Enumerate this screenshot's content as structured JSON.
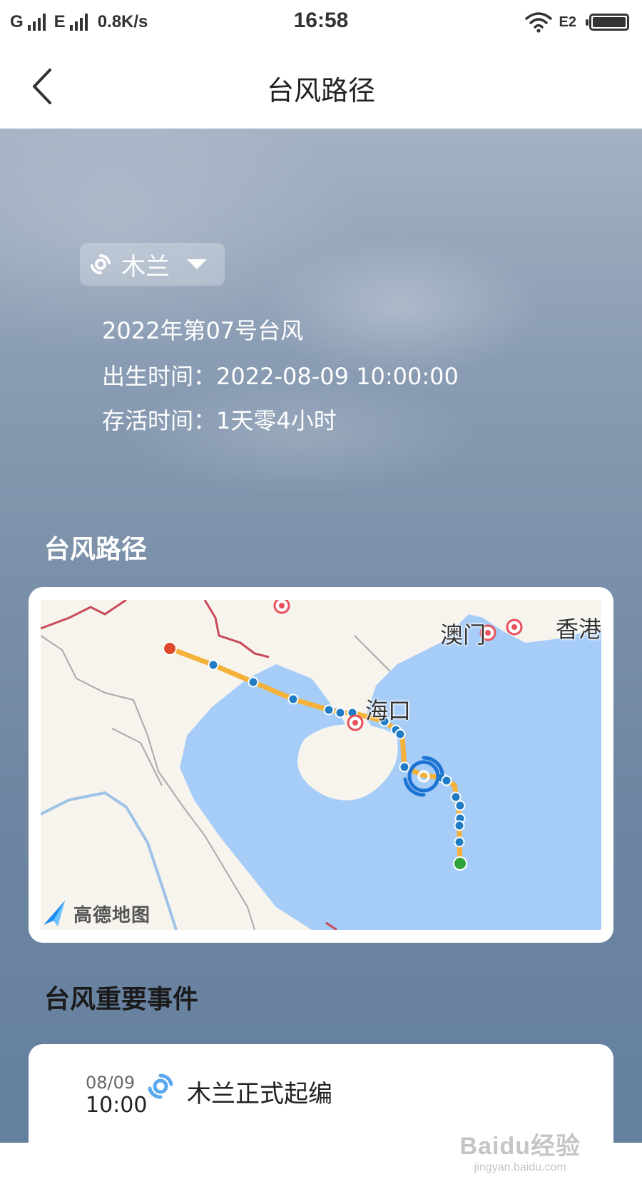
{
  "status_bar": {
    "sim1": "G",
    "sim2": "E",
    "speed": "0.8K/s",
    "time": "16:58",
    "network_badge": "E2",
    "icons": [
      "signal-icon",
      "wifi-icon",
      "battery-icon"
    ]
  },
  "nav": {
    "title": "台风路径"
  },
  "typhoon": {
    "name": "木兰",
    "code_label": "2022年第07号台风",
    "birth_label": "出生时间：2022-08-09 10:00:00",
    "alive_label": "存活时间：1天零4小时",
    "icon": "typhoon-icon"
  },
  "sections": {
    "path_title": "台风路径",
    "events_title": "台风重要事件"
  },
  "map": {
    "provider": "高德地图",
    "labels": {
      "haikou": "海口",
      "macau": "澳门",
      "hongkong": "香港"
    },
    "colors": {
      "sea": "#a6cdf8",
      "land": "#f7f4ee",
      "track": "#f4b23a",
      "point": "#1f7cc5",
      "start": "#2da339",
      "end": "#e0482e",
      "city": "#e8505b"
    }
  },
  "events": [
    {
      "date": "08/09",
      "time": "10:00",
      "text": "木兰正式起编"
    }
  ],
  "watermark": {
    "main": "Baidu经验",
    "sub": "jingyan.baidu.com"
  }
}
